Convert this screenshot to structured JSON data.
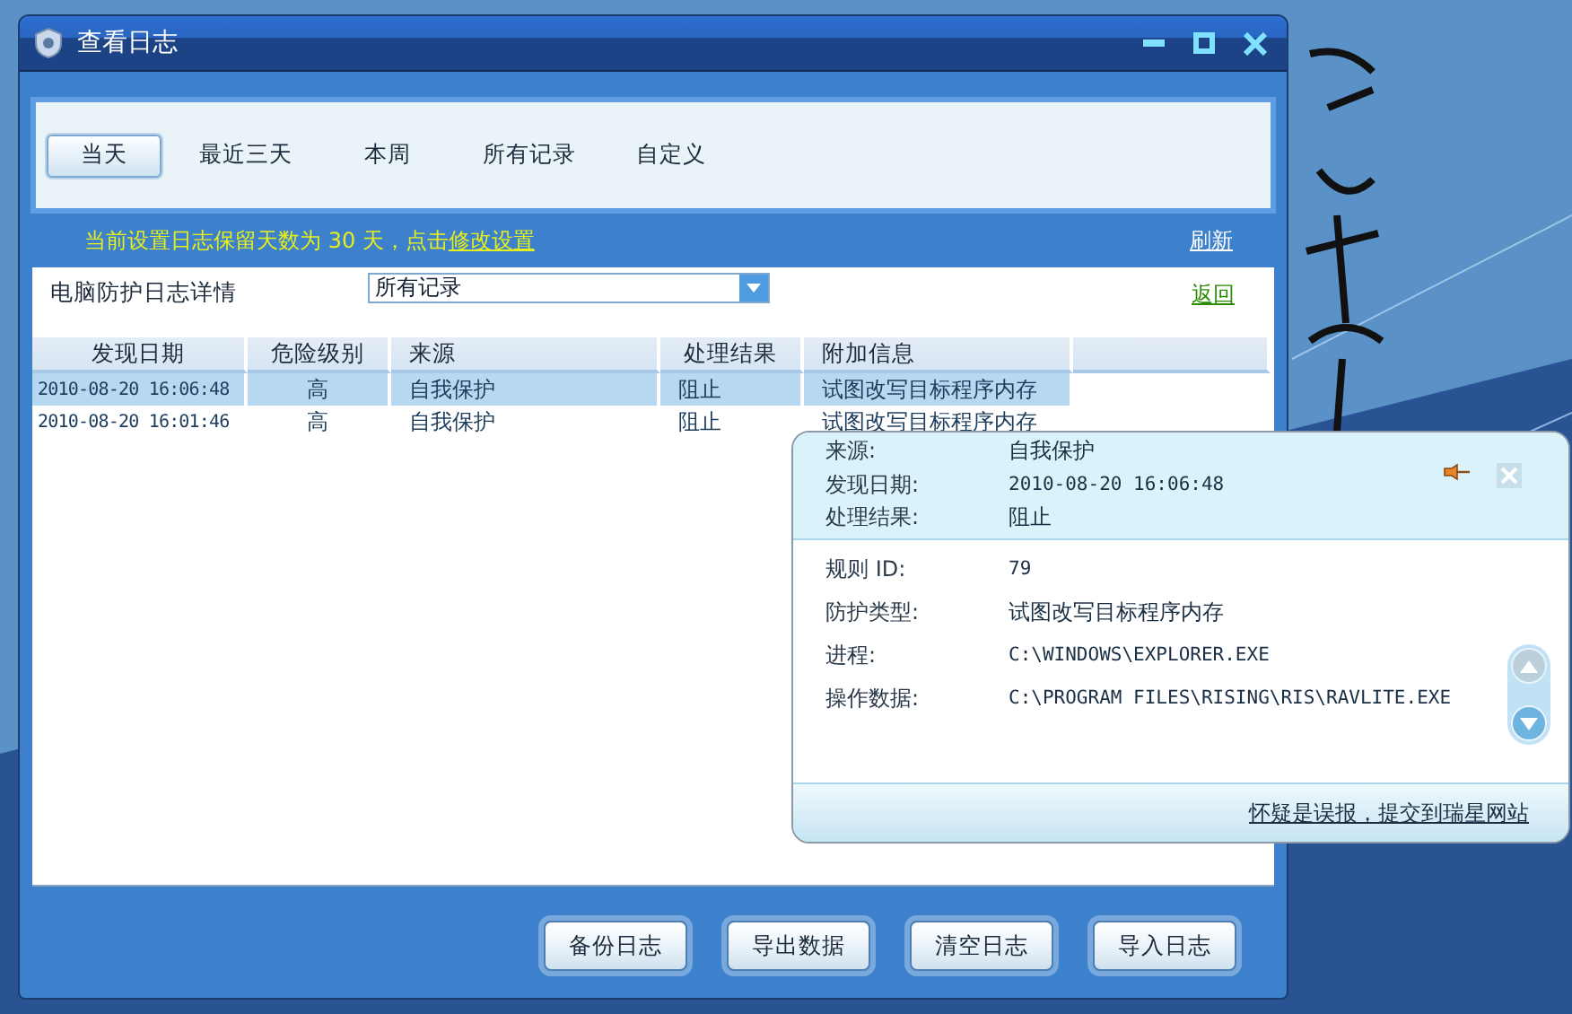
{
  "window": {
    "title": "查看日志"
  },
  "tabs": [
    {
      "label": "当天",
      "selected": true
    },
    {
      "label": "最近三天",
      "selected": false
    },
    {
      "label": "本周",
      "selected": false
    },
    {
      "label": "所有记录",
      "selected": false
    },
    {
      "label": "自定义",
      "selected": false
    }
  ],
  "notice": {
    "text": "当前设置日志保留天数为 30 天，点击",
    "link": "修改设置"
  },
  "refresh_link": "刷新",
  "log_panel": {
    "label": "电脑防护日志详情",
    "filter": {
      "value": "所有记录"
    },
    "back_link": "返回"
  },
  "table": {
    "columns": [
      "发现日期",
      "危险级别",
      "来源",
      "处理结果",
      "附加信息"
    ],
    "rows": [
      {
        "cells": [
          "2010-08-20 16:06:48",
          "高",
          "自我保护",
          "阻止",
          "试图改写目标程序内存"
        ],
        "selected": true
      },
      {
        "cells": [
          "2010-08-20 16:01:46",
          "高",
          "自我保护",
          "阻止",
          "试图改写目标程序内存"
        ],
        "selected": false
      }
    ]
  },
  "buttons": [
    "备份日志",
    "导出数据",
    "清空日志",
    "导入日志"
  ],
  "detail_popup": {
    "header": [
      {
        "label": "来源:",
        "value": "自我保护"
      },
      {
        "label": "发现日期:",
        "value": "2010-08-20 16:06:48"
      },
      {
        "label": "处理结果:",
        "value": "阻止"
      }
    ],
    "fields": [
      {
        "label": "规则 ID:",
        "value": "79"
      },
      {
        "label": "防护类型:",
        "value": "试图改写目标程序内存"
      },
      {
        "label": "进程:",
        "value": "C:\\WINDOWS\\EXPLORER.EXE"
      },
      {
        "label": "操作数据:",
        "value": "C:\\PROGRAM FILES\\RISING\\RIS\\RAVLITE.EXE"
      }
    ],
    "footer_link": "怀疑是误报，提交到瑞星网站"
  }
}
